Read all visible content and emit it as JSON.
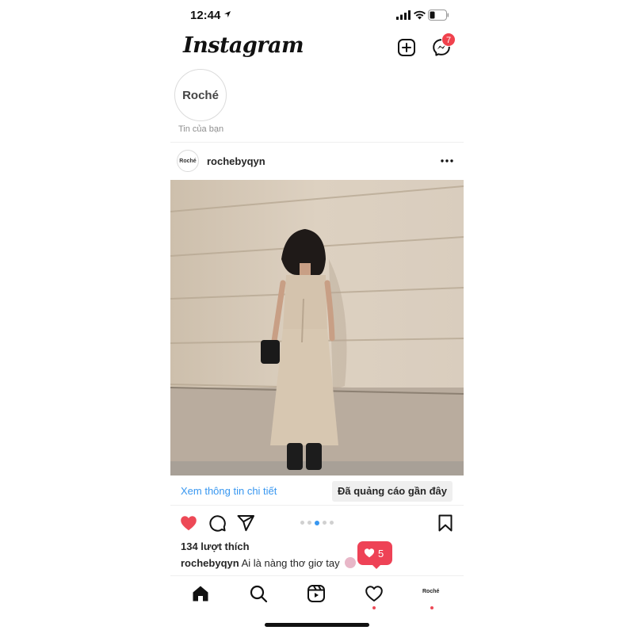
{
  "status_bar": {
    "time": "12:44"
  },
  "header": {
    "logo": "Instagram",
    "messenger_badge": "7"
  },
  "stories": {
    "own_avatar_text": "Roché",
    "own_caption": "Tin của bạn"
  },
  "post": {
    "avatar_text": "Roché",
    "username": "rochebyqyn",
    "cta_link": "Xem thông tin chi tiết",
    "sponsored_label": "Đã quảng cáo gần đây",
    "likes": "134 lượt thích",
    "caption_user": "rochebyqyn",
    "caption_text": "Ai là nàng thơ giơ tay",
    "carousel_total": 5,
    "carousel_active": 3
  },
  "notification": {
    "count": "5"
  },
  "tab_bar": {
    "profile_text": "Roché"
  },
  "colors": {
    "like_red": "#ed4956",
    "link_blue": "#3897f0",
    "badge_red": "#f0424d"
  },
  "icons": [
    "location-arrow-icon",
    "signal-icon",
    "wifi-icon",
    "battery-icon",
    "new-post-icon",
    "messenger-icon",
    "more-icon",
    "heart-filled-icon",
    "comment-icon",
    "share-icon",
    "bookmark-icon",
    "home-icon",
    "search-icon",
    "reels-icon",
    "heart-outline-icon"
  ]
}
